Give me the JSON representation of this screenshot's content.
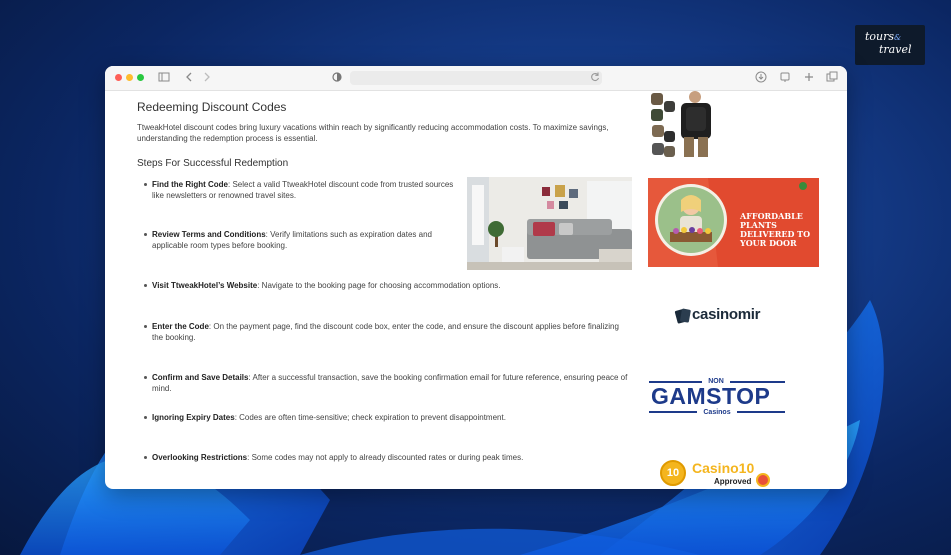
{
  "logo": {
    "text": "tours",
    "text2": "travel",
    "sub": "&"
  },
  "article": {
    "title": "Redeeming Discount Codes",
    "intro": "TtweakHotel discount codes bring luxury vacations within reach by significantly reducing accommodation costs. To maximize savings, understanding the redemption process is essential.",
    "steps_title": "Steps For Successful Redemption",
    "items": [
      {
        "term": "Find the Right Code",
        "text": ": Select a valid TtweakHotel discount code from trusted sources like newsletters or renowned travel sites."
      },
      {
        "term": "Review Terms and Conditions",
        "text": ": Verify limitations such as expiration dates and applicable room types before booking."
      },
      {
        "term": "Visit TtweakHotel’s Website",
        "text": ": Navigate to the booking page for choosing accommodation options."
      },
      {
        "term": "Enter the Code",
        "text": ": On the payment page, find the discount code box, enter the code, and ensure the discount applies before finalizing the booking."
      },
      {
        "term": "Confirm and Save Details",
        "text": ": After a successful transaction, save the booking confirmation email for future reference, ensuring peace of mind."
      },
      {
        "term": "Ignoring Expiry Dates",
        "text": ": Codes are often time-sensitive; check expiration to prevent disappointment."
      },
      {
        "term": "Overlooking Restrictions",
        "text": ": Some codes may not apply to already discounted rates or during peak times."
      }
    ]
  },
  "ads": {
    "plants": "AFFORDABLE PLANTS DELIVERED TO YOUR DOOR",
    "casinomir": "casinomir",
    "gamstop_non": "NON",
    "gamstop": "GAMSTOP",
    "gamstop_sub": "Casinos",
    "casino10": "Casino10",
    "casino10_num": "10",
    "casino10_sub": "Approved"
  }
}
